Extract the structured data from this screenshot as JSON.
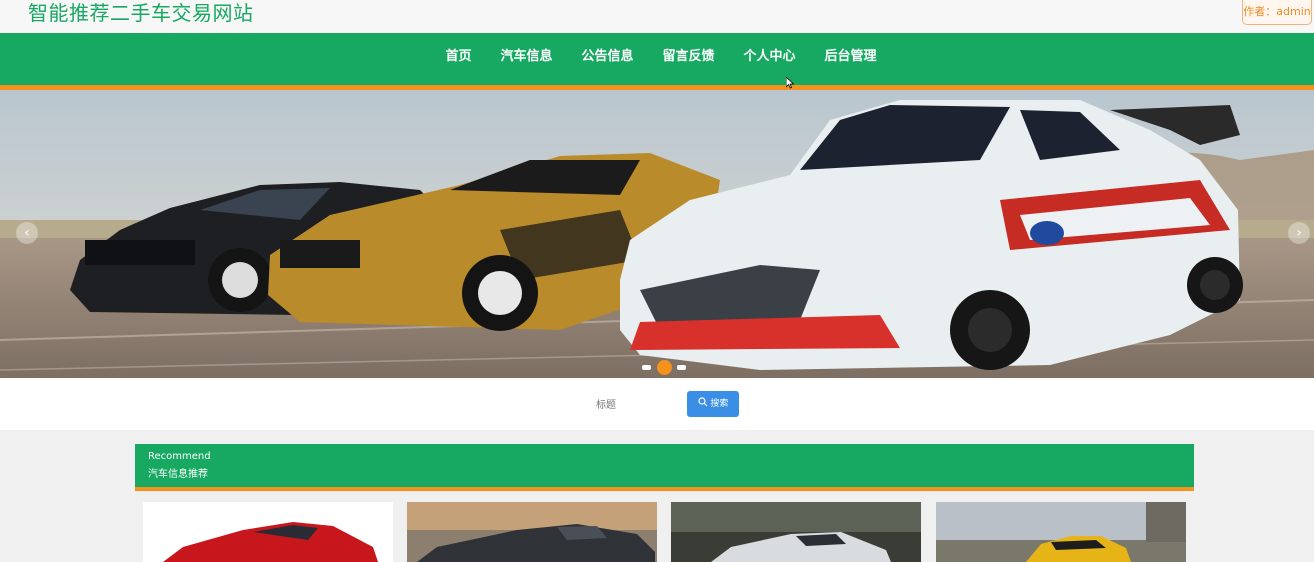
{
  "site": {
    "title": "智能推荐二手车交易网站",
    "author_badge": "作者：admin"
  },
  "nav": {
    "items": [
      "首页",
      "汽车信息",
      "公告信息",
      "留言反馈",
      "个人中心",
      "后台管理"
    ]
  },
  "carousel": {
    "prev": "‹",
    "next": "›",
    "dots": 3,
    "active_dot": 1
  },
  "search": {
    "label": "标题",
    "button": "搜索"
  },
  "recommend": {
    "title_en": "Recommend",
    "title_cn": "汽车信息推荐"
  },
  "colors": {
    "primary": "#17a862",
    "accent": "#f5921e",
    "button": "#3a8ee6"
  }
}
